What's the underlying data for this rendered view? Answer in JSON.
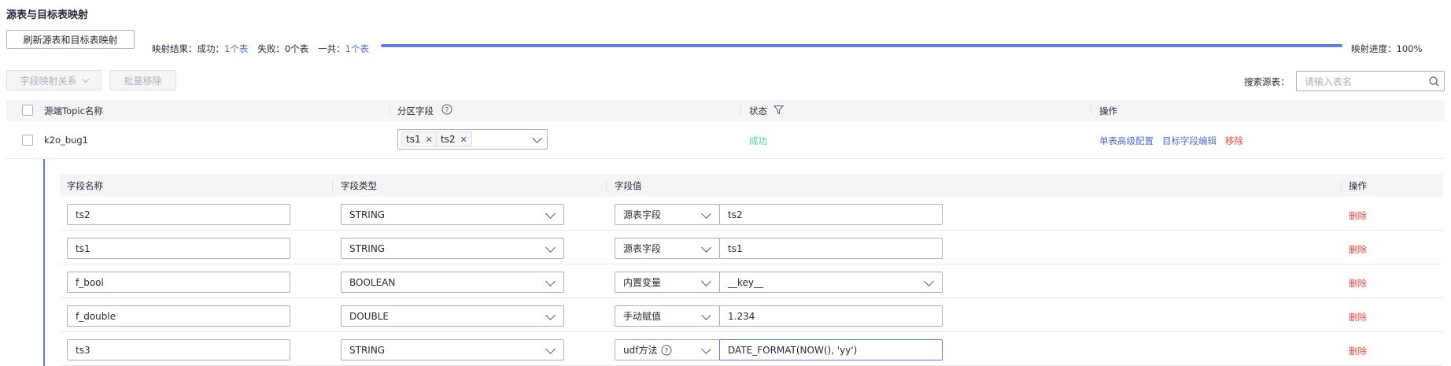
{
  "section_title": "源表与目标表映射",
  "toolbar": {
    "refresh_label": "刷新源表和目标表映射",
    "result_label": "映射结果：",
    "success_label": "成功：",
    "success_value": "1个表",
    "fail_label": "失败：",
    "fail_value": "0个表",
    "total_label": "一共：",
    "total_value": "1个表",
    "progress_percent": 100,
    "progress_label": "映射进度：",
    "progress_value": "100%"
  },
  "actions": {
    "field_mapping_label": "字段映射关系",
    "batch_remove_label": "批量移除",
    "search_label": "搜索源表：",
    "search_placeholder": "请输入表名"
  },
  "table": {
    "headers": {
      "source_topic": "源端Topic名称",
      "partition_field": "分区字段",
      "status": "状态",
      "operation": "操作"
    },
    "row": {
      "name": "k2o_bug1",
      "partition_tags": [
        "ts1",
        "ts2"
      ],
      "status": "成功",
      "op_advanced": "单表高级配置",
      "op_edit_target": "目标字段编辑",
      "op_remove": "移除"
    }
  },
  "subtable": {
    "headers": {
      "field_name": "字段名称",
      "field_type": "字段类型",
      "field_value": "字段值",
      "operation": "操作"
    },
    "rows": [
      {
        "name": "ts2",
        "type": "STRING",
        "value_mode": "源表字段",
        "value": "ts2",
        "delete": "删除"
      },
      {
        "name": "ts1",
        "type": "STRING",
        "value_mode": "源表字段",
        "value": "ts1",
        "delete": "删除"
      },
      {
        "name": "f_bool",
        "type": "BOOLEAN",
        "value_mode": "内置变量",
        "value": "__key__",
        "delete": "删除"
      },
      {
        "name": "f_double",
        "type": "DOUBLE",
        "value_mode": "手动赋值",
        "value": "1.234",
        "delete": "删除"
      },
      {
        "name": "ts3",
        "type": "STRING",
        "value_mode": "udf方法",
        "value": "DATE_FORMAT(NOW(), 'yy')",
        "delete": "删除"
      }
    ]
  },
  "colors": {
    "accent": "#5e7ce0",
    "link": "#526ecc",
    "danger": "#e54545",
    "success": "#50d4ab"
  }
}
